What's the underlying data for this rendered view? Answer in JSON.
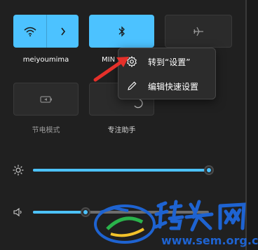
{
  "tiles": [
    {
      "label": "meiyoumima",
      "state": "on",
      "icon": "wifi-icon"
    },
    {
      "label": "MIN",
      "state": "on",
      "icon": "bluetooth-icon"
    },
    {
      "label": "",
      "state": "off",
      "icon": "airplane-icon"
    },
    {
      "label": "节电模式",
      "state": "off",
      "icon": "battery-saver-icon"
    },
    {
      "label": "专注助手",
      "state": "off",
      "icon": "focus-assist-icon"
    }
  ],
  "sliders": {
    "brightness": {
      "icon": "brightness-icon",
      "value": 1.0
    },
    "volume": {
      "icon": "speaker-icon",
      "value": 0.3
    }
  },
  "context_menu": {
    "items": [
      {
        "label": "转到“设置”",
        "icon": "gear-icon"
      },
      {
        "label": "编辑快速设置",
        "icon": "pencil-icon"
      }
    ]
  },
  "watermark": {
    "text": "www.sem.org.cn",
    "logo": "站长网"
  },
  "colors": {
    "accent": "#4cc2ff",
    "panel": "#202020",
    "tile_off": "#2b2b2b",
    "arrow": "#e5302a",
    "watermark": "#1e63d1"
  }
}
